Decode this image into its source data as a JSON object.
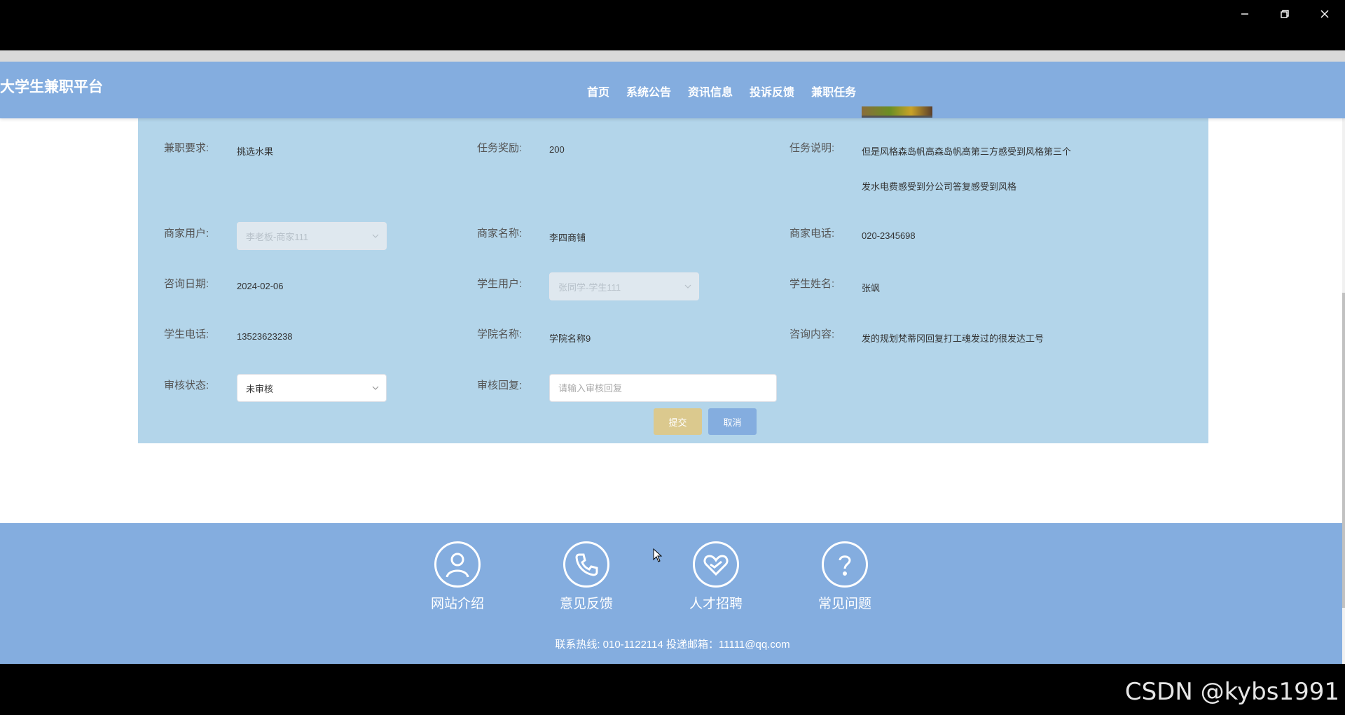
{
  "window": {
    "minimize": "minimize",
    "maximize": "restore",
    "close": "close"
  },
  "brand": "大学生兼职平台",
  "nav": [
    "首页",
    "系统公告",
    "资讯信息",
    "投诉反馈",
    "兼职任务"
  ],
  "form": {
    "job_req_label": "兼职要求:",
    "job_req_value": "挑选水果",
    "reward_label": "任务奖励:",
    "reward_value": "200",
    "desc_label": "任务说明:",
    "desc_line1": "但是风格森岛帆高森岛帆高第三方感受到风格第三个",
    "desc_line2": "发水电费感受到分公司答复感受到风格",
    "merchant_user_label": "商家用户:",
    "merchant_user_value": "李老板-商家111",
    "merchant_name_label": "商家名称:",
    "merchant_name_value": "李四商铺",
    "merchant_phone_label": "商家电话:",
    "merchant_phone_value": "020-2345698",
    "consult_date_label": "咨询日期:",
    "consult_date_value": "2024-02-06",
    "student_user_label": "学生用户:",
    "student_user_value": "张同学-学生111",
    "student_name_label": "学生姓名:",
    "student_name_value": "张飒",
    "student_phone_label": "学生电话:",
    "student_phone_value": "13523623238",
    "college_label": "学院名称:",
    "college_value": "学院名称9",
    "consult_content_label": "咨询内容:",
    "consult_content_value": "发的规划梵蒂冈回复打工魂发过的很发达工号",
    "audit_status_label": "审核状态:",
    "audit_status_value": "未审核",
    "audit_reply_label": "审核回复:",
    "audit_reply_placeholder": "请输入审核回复",
    "submit": "提交",
    "cancel": "取消"
  },
  "footer": {
    "items": [
      "网站介绍",
      "意见反馈",
      "人才招聘",
      "常见问题"
    ],
    "contact": "联系热线: 010-1122114 投递邮箱：11111@qq.com"
  },
  "watermark": "CSDN @kybs1991",
  "colors": {
    "nav": "#84addf",
    "panel": "#b3d5ea",
    "submit": "#dbc98e",
    "cancel": "#84addf"
  }
}
